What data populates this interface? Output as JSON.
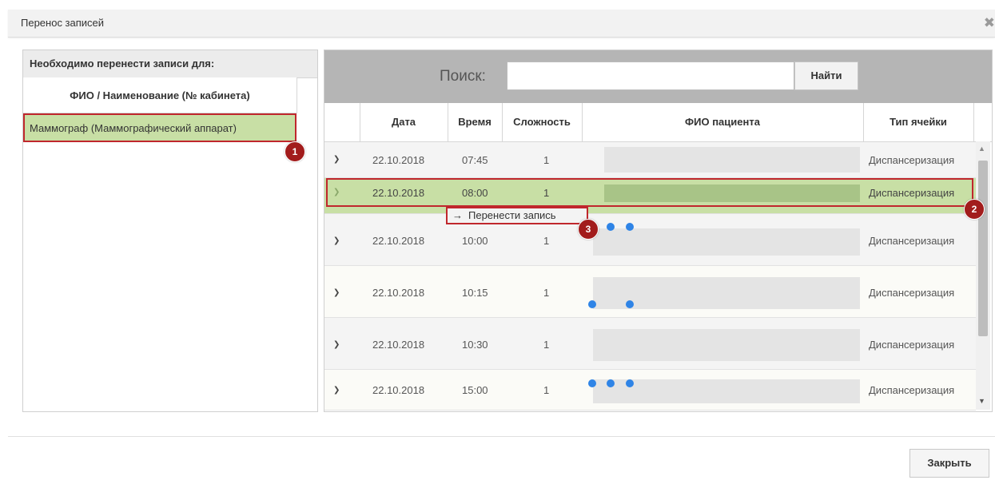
{
  "dialog": {
    "title": "Перенос записей",
    "close_icon": "close-icon"
  },
  "left_panel": {
    "title": "Необходимо перенести записи для:",
    "column_header": "ФИО / Наименование (№ кабинета)",
    "items": [
      {
        "label": "Маммограф (Маммографический аппарат)",
        "selected": true
      }
    ]
  },
  "search": {
    "label": "Поиск:",
    "value": "",
    "placeholder": "",
    "button_label": "Найти"
  },
  "table": {
    "columns": [
      "Дата",
      "Время",
      "Сложность",
      "ФИО пациента",
      "Тип ячейки"
    ],
    "rows": [
      {
        "date": "22.10.2018",
        "time": "07:45",
        "complexity": "1",
        "patient": "",
        "cell_type": "Диспансеризация",
        "highlighted": false
      },
      {
        "date": "22.10.2018",
        "time": "08:00",
        "complexity": "1",
        "patient": "",
        "cell_type": "Диспансеризация",
        "highlighted": true
      },
      {
        "date": "22.10.2018",
        "time": "10:00",
        "complexity": "1",
        "patient": "",
        "cell_type": "Диспансеризация",
        "highlighted": false
      },
      {
        "date": "22.10.2018",
        "time": "10:15",
        "complexity": "1",
        "patient": "",
        "cell_type": "Диспансеризация",
        "highlighted": false
      },
      {
        "date": "22.10.2018",
        "time": "10:30",
        "complexity": "1",
        "patient": "",
        "cell_type": "Диспансеризация",
        "highlighted": false
      },
      {
        "date": "22.10.2018",
        "time": "15:00",
        "complexity": "1",
        "patient": "",
        "cell_type": "Диспансеризация",
        "highlighted": false
      }
    ]
  },
  "context_menu": {
    "arrow": "→",
    "item_label": "Перенести запись"
  },
  "annotations": [
    "1",
    "2",
    "3"
  ],
  "footer": {
    "close_button_label": "Закрыть"
  },
  "colors": {
    "highlight_green": "#c8dfa5",
    "annotation_red": "#c0272d",
    "badge_red": "#a21c1c",
    "search_bar_gray": "#b5b5b5",
    "dot_blue": "#2f84e6"
  }
}
